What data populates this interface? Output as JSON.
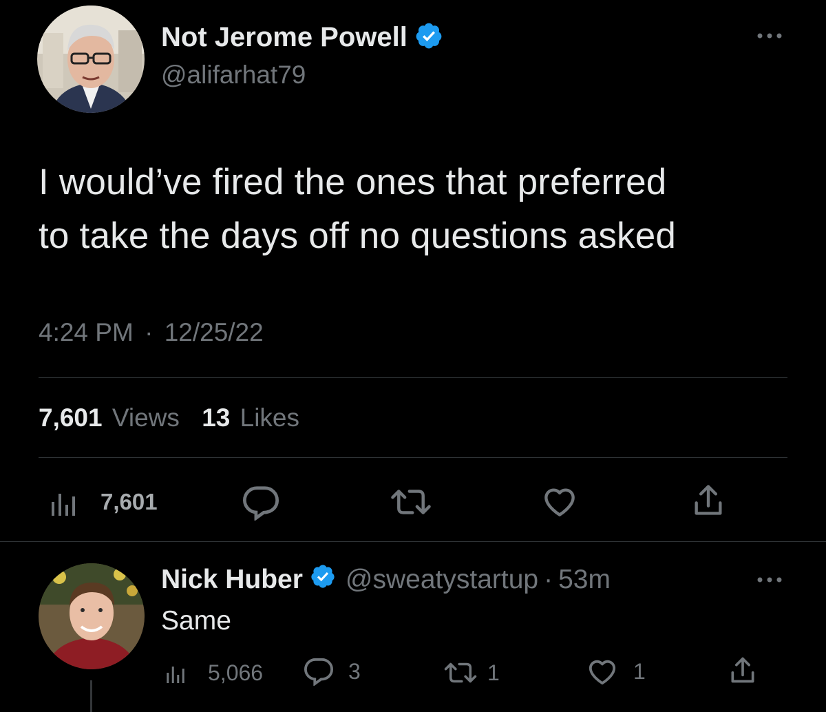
{
  "main_tweet": {
    "author": {
      "display_name": "Not Jerome Powell",
      "handle": "@alifarhat79",
      "verified": true
    },
    "text_line1": "I would’ve fired the ones that preferred",
    "text_line2": "to take the days off no questions asked",
    "time": "4:24 PM",
    "date": "12/25/22",
    "separator": "·",
    "stats": {
      "views_count": "7,601",
      "views_label": "Views",
      "likes_count": "13",
      "likes_label": "Likes"
    },
    "actions": {
      "analytics_count": "7,601",
      "analytics_icon": "bar-chart-icon",
      "reply_icon": "reply-bubble-icon",
      "retweet_icon": "retweet-icon",
      "like_icon": "heart-icon",
      "share_icon": "share-icon"
    }
  },
  "reply_tweet": {
    "author": {
      "display_name": "Nick Huber",
      "handle": "@sweatystartup",
      "verified": true
    },
    "separator": "·",
    "age": "53m",
    "text": "Same",
    "actions": {
      "analytics_count": "5,066",
      "reply_count": "3",
      "retweet_count": "1",
      "like_count": "1"
    }
  },
  "colors": {
    "background": "#000000",
    "primary_text": "#e7e9ea",
    "secondary_text": "#71767b",
    "verified_badge": "#1d9bf0",
    "divider": "#2f3336"
  }
}
